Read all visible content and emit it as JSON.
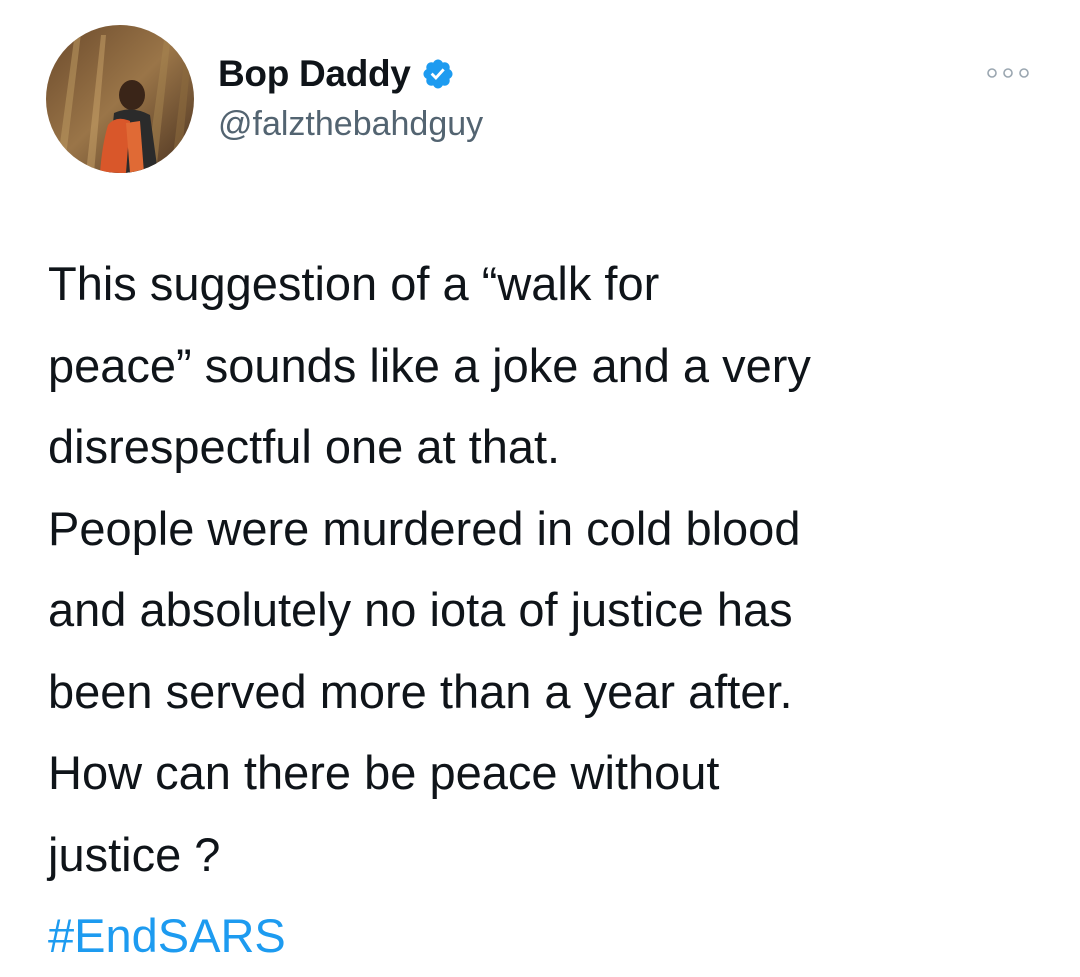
{
  "author": {
    "display_name": "Bop Daddy",
    "handle": "@falzthebahdguy",
    "verified": true,
    "avatar_icon": "profile-photo",
    "verified_icon": "verified-badge-icon"
  },
  "more_icon": "more-options-icon",
  "tweet": {
    "lines": [
      "This suggestion of a “walk for",
      "peace” sounds like a joke and a very",
      "disrespectful one at that.",
      "People were murdered in cold blood",
      "and absolutely no iota of justice has",
      "been served more than a year after.",
      "How can there be peace without",
      "justice ?"
    ],
    "hashtag": "#EndSARS"
  },
  "colors": {
    "text": "#0f1419",
    "secondary": "#536471",
    "accent": "#1d9bf0"
  }
}
